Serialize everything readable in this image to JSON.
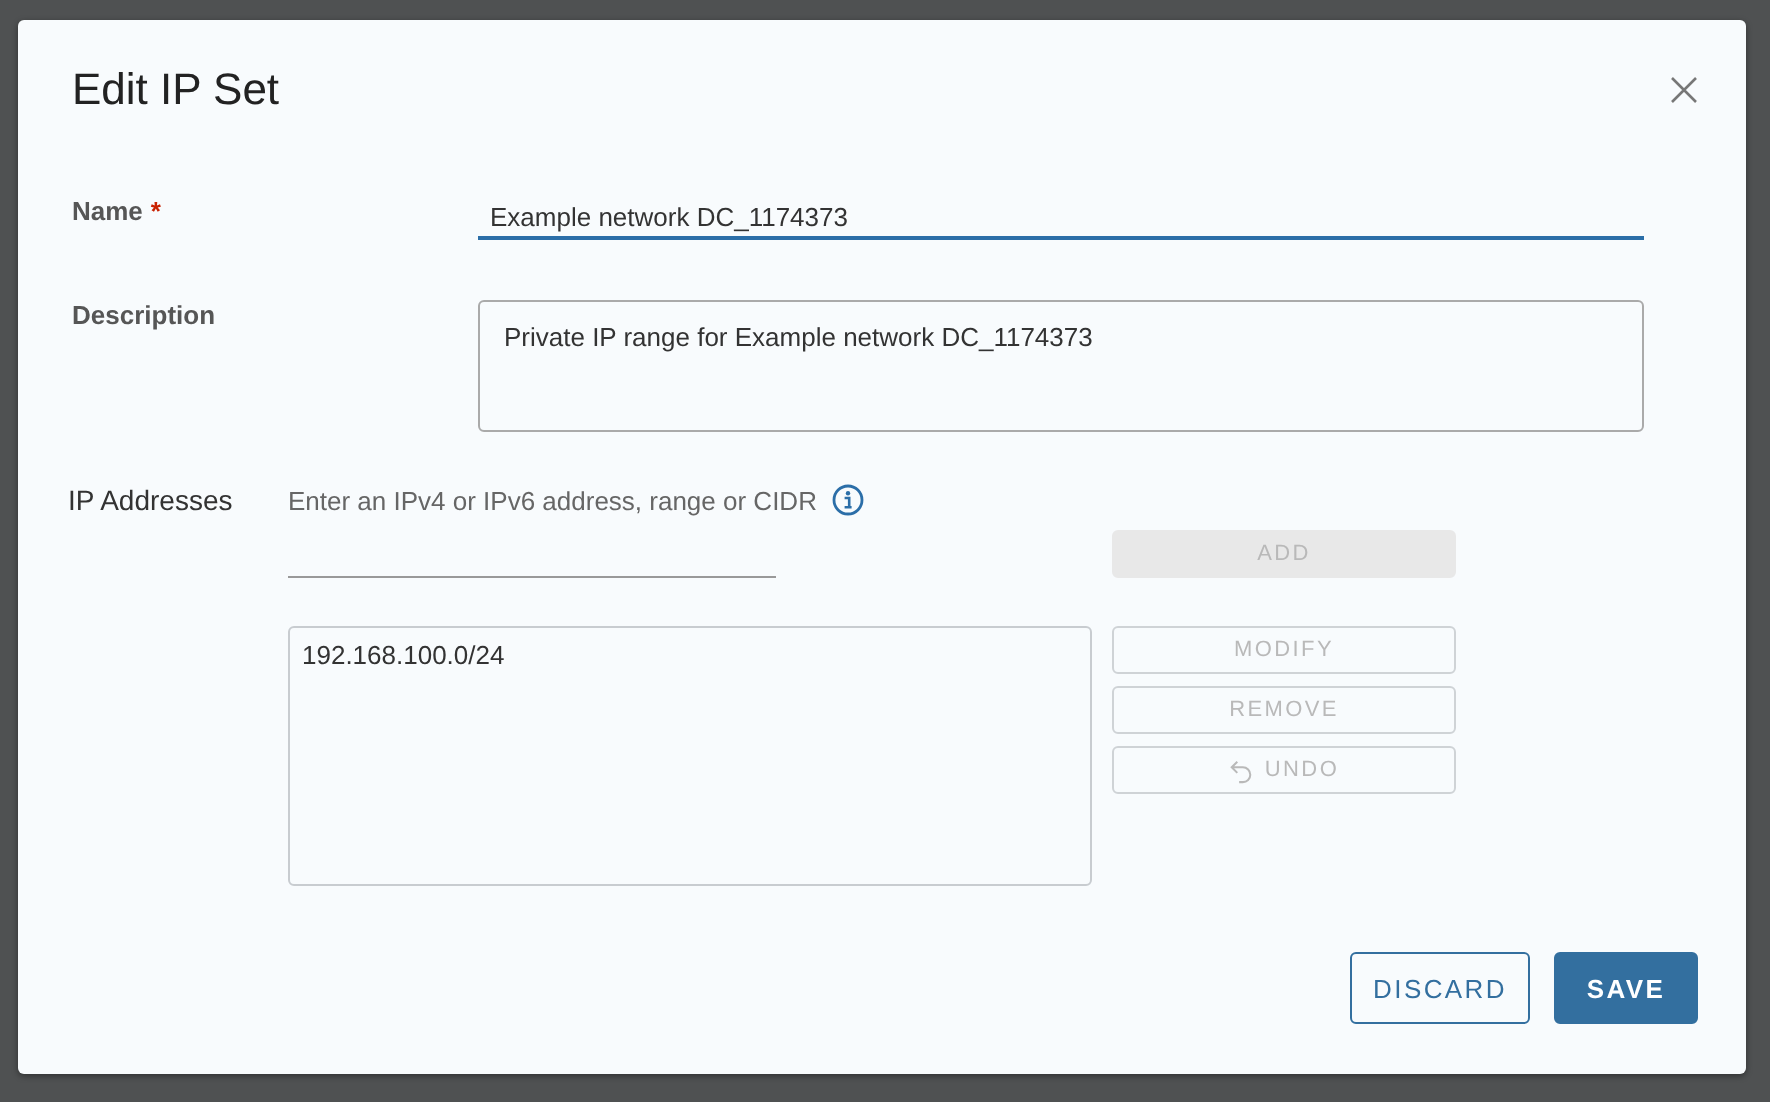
{
  "dialog": {
    "title": "Edit IP Set",
    "fields": [
      {
        "label": "Name",
        "required_mark": "*",
        "kind": "text",
        "value": "Example network DC_1174373",
        "focused": true
      },
      {
        "label": "Description",
        "kind": "textarea",
        "value": "Private IP range for Example network DC_1174373",
        "focused": false
      }
    ],
    "ip_addresses": {
      "label": "IP Addresses",
      "hint": "Enter an IPv4 or IPv6 address, range or CIDR",
      "entries": [
        {
          "text": "192.168.100.0/24",
          "selected": false
        }
      ],
      "buttons": [
        {
          "label": "ADD",
          "kind": "solid",
          "disabled": true
        },
        {
          "label": "MODIFY",
          "kind": "outline",
          "disabled": true
        },
        {
          "label": "REMOVE",
          "kind": "outline",
          "disabled": true
        },
        {
          "label": "UNDO",
          "kind": "undo",
          "disabled": true
        }
      ]
    },
    "footer_buttons": [
      {
        "label": "DISCARD",
        "kind": "outline",
        "disabled": false
      },
      {
        "label": "SAVE",
        "kind": "primary",
        "disabled": false
      }
    ]
  }
}
